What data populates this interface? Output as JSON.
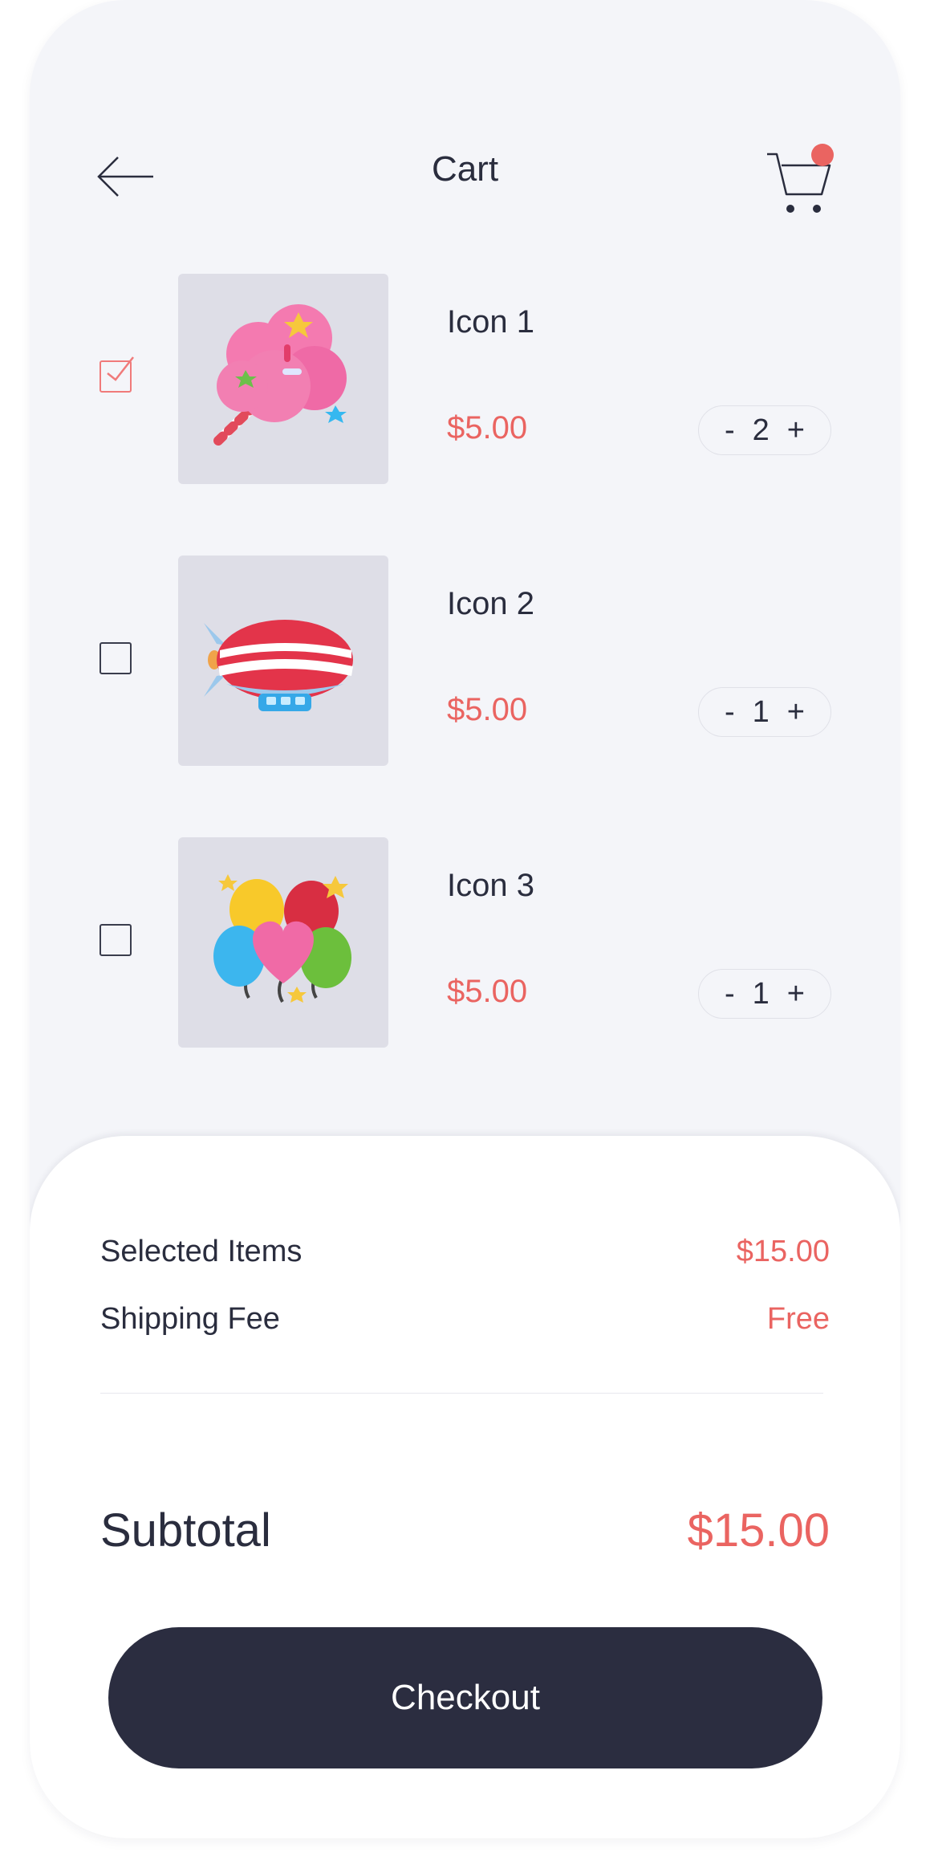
{
  "header": {
    "title": "Cart",
    "back_icon": "arrow-left-icon",
    "cart_icon": "shopping-cart-icon",
    "cart_badge_color": "#ea6461"
  },
  "items": [
    {
      "name": "Icon 1",
      "price": "$5.00",
      "quantity": "2",
      "selected": true,
      "image": "cotton-candy-icon"
    },
    {
      "name": "Icon 2",
      "price": "$5.00",
      "quantity": "1",
      "selected": false,
      "image": "airship-icon"
    },
    {
      "name": "Icon 3",
      "price": "$5.00",
      "quantity": "1",
      "selected": false,
      "image": "balloons-icon"
    }
  ],
  "stepper": {
    "minus": "-",
    "plus": "+"
  },
  "summary": {
    "selected_label": "Selected Items",
    "selected_value": "$15.00",
    "shipping_label": "Shipping Fee",
    "shipping_value": "Free",
    "subtotal_label": "Subtotal",
    "subtotal_value": "$15.00"
  },
  "checkout_label": "Checkout",
  "colors": {
    "accent": "#ea6461",
    "dark": "#2b2d40",
    "background": "#f4f5f9"
  }
}
